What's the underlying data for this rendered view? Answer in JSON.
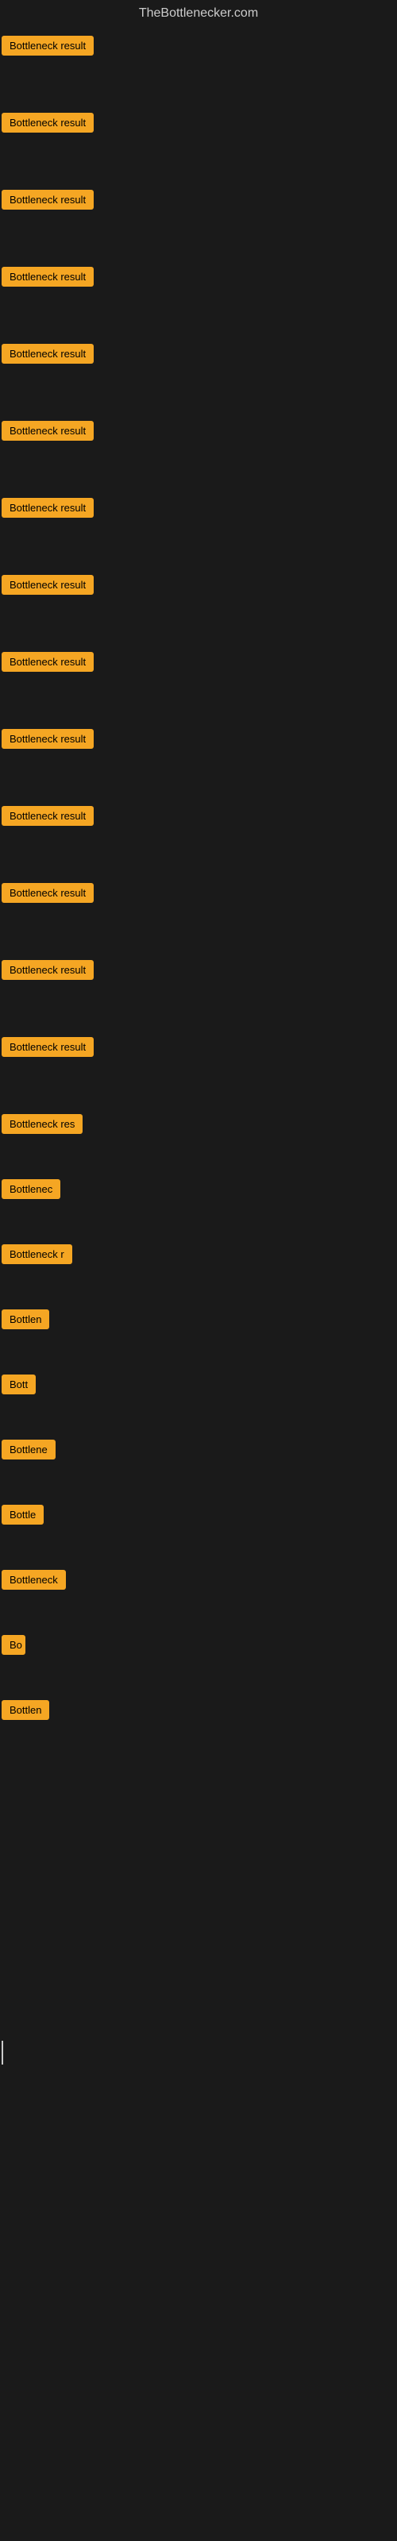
{
  "header": {
    "title": "TheBottlenecker.com"
  },
  "items": [
    {
      "id": 1,
      "label": "Bottleneck result",
      "width": 130
    },
    {
      "id": 2,
      "label": "Bottleneck result",
      "width": 130
    },
    {
      "id": 3,
      "label": "Bottleneck result",
      "width": 130
    },
    {
      "id": 4,
      "label": "Bottleneck result",
      "width": 130
    },
    {
      "id": 5,
      "label": "Bottleneck result",
      "width": 130
    },
    {
      "id": 6,
      "label": "Bottleneck result",
      "width": 130
    },
    {
      "id": 7,
      "label": "Bottleneck result",
      "width": 130
    },
    {
      "id": 8,
      "label": "Bottleneck result",
      "width": 130
    },
    {
      "id": 9,
      "label": "Bottleneck result",
      "width": 130
    },
    {
      "id": 10,
      "label": "Bottleneck result",
      "width": 130
    },
    {
      "id": 11,
      "label": "Bottleneck result",
      "width": 130
    },
    {
      "id": 12,
      "label": "Bottleneck result",
      "width": 130
    },
    {
      "id": 13,
      "label": "Bottleneck result",
      "width": 130
    },
    {
      "id": 14,
      "label": "Bottleneck result",
      "width": 130
    },
    {
      "id": 15,
      "label": "Bottleneck res",
      "width": 110
    },
    {
      "id": 16,
      "label": "Bottlenec",
      "width": 80
    },
    {
      "id": 17,
      "label": "Bottleneck r",
      "width": 90
    },
    {
      "id": 18,
      "label": "Bottlen",
      "width": 68
    },
    {
      "id": 19,
      "label": "Bott",
      "width": 45
    },
    {
      "id": 20,
      "label": "Bottlene",
      "width": 72
    },
    {
      "id": 21,
      "label": "Bottle",
      "width": 55
    },
    {
      "id": 22,
      "label": "Bottleneck",
      "width": 82
    },
    {
      "id": 23,
      "label": "Bo",
      "width": 30
    },
    {
      "id": 24,
      "label": "Bottlen",
      "width": 65
    }
  ]
}
